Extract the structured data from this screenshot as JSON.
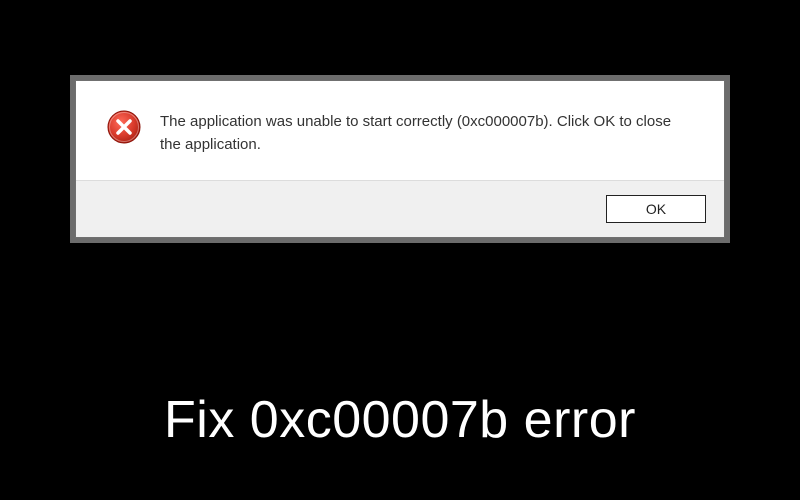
{
  "dialog": {
    "message": "The application was unable to start correctly (0xc000007b). Click OK to close the application.",
    "ok_label": "OK",
    "icon": "error-icon"
  },
  "caption": "Fix 0xc00007b error",
  "colors": {
    "error_red_outer": "#c0392b",
    "error_red_inner": "#e74c3c",
    "white": "#ffffff"
  }
}
